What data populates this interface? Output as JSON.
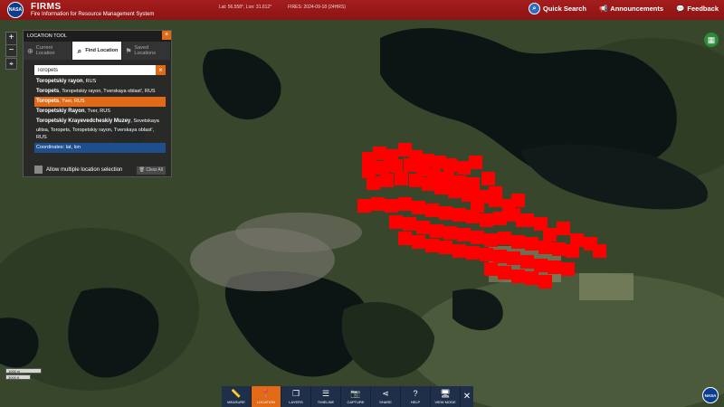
{
  "header": {
    "logo_text": "NASA",
    "title": "FIRMS",
    "subtitle": "Fire Information for Resource Management System",
    "coords": "Lat: 56.558°, Lon: 31.612°",
    "fires": "FIRES: 2024-09-18 (24HRS)",
    "quick_search": "Quick Search",
    "announcements": "Announcements",
    "feedback": "Feedback"
  },
  "zoom": {
    "in": "+",
    "out": "−"
  },
  "location_tool": {
    "title": "LOCATION TOOL",
    "tabs": [
      {
        "label": "Current Location",
        "icon": "crosshair-icon"
      },
      {
        "label": "Find Location",
        "icon": "search-icon"
      },
      {
        "label": "Saved Locations",
        "icon": "flag-icon"
      }
    ],
    "search_value": "Toropets",
    "results": [
      {
        "name": "Toropetskiy rayon",
        "detail": ", RUS"
      },
      {
        "name": "Toropets",
        "detail": ", Toropetskiy rayon, Tverskaya oblast', RUS"
      },
      {
        "name": "Toropets",
        "detail": ", Tver, RUS"
      },
      {
        "name": "Toropetskiy Rayon",
        "detail": ", Tver, RUS"
      },
      {
        "name": "Toropetskiy Krayevedcheskiy Muzey",
        "detail": ", Sovetskaya ulitsa, Toropets, Toropetskiy rayon, Tverskaya oblast', RUS"
      }
    ],
    "coordinates_label": "Coordinates: lat, lon",
    "multi_label": "Allow multiple location selection",
    "clear_all": "Clear All"
  },
  "scale": {
    "km": "1000 m",
    "ft": "3000 ft"
  },
  "toolbar": [
    {
      "label": "MEASURE",
      "icon": "ruler-icon"
    },
    {
      "label": "LOCATION",
      "icon": "pin-icon"
    },
    {
      "label": "LAYERS",
      "icon": "layers-icon"
    },
    {
      "label": "TIMELINE",
      "icon": "sliders-icon"
    },
    {
      "label": "CAPTURE",
      "icon": "camera-icon"
    },
    {
      "label": "SHARE",
      "icon": "share-icon"
    },
    {
      "label": "HELP",
      "icon": "help-icon"
    },
    {
      "label": "VIEW MODE",
      "icon": "monitor-icon"
    }
  ],
  "colors": {
    "header": "#a51d1d",
    "accent": "#e06a15",
    "fire": "#ff0000",
    "toolbar": "#1f2f4a"
  }
}
